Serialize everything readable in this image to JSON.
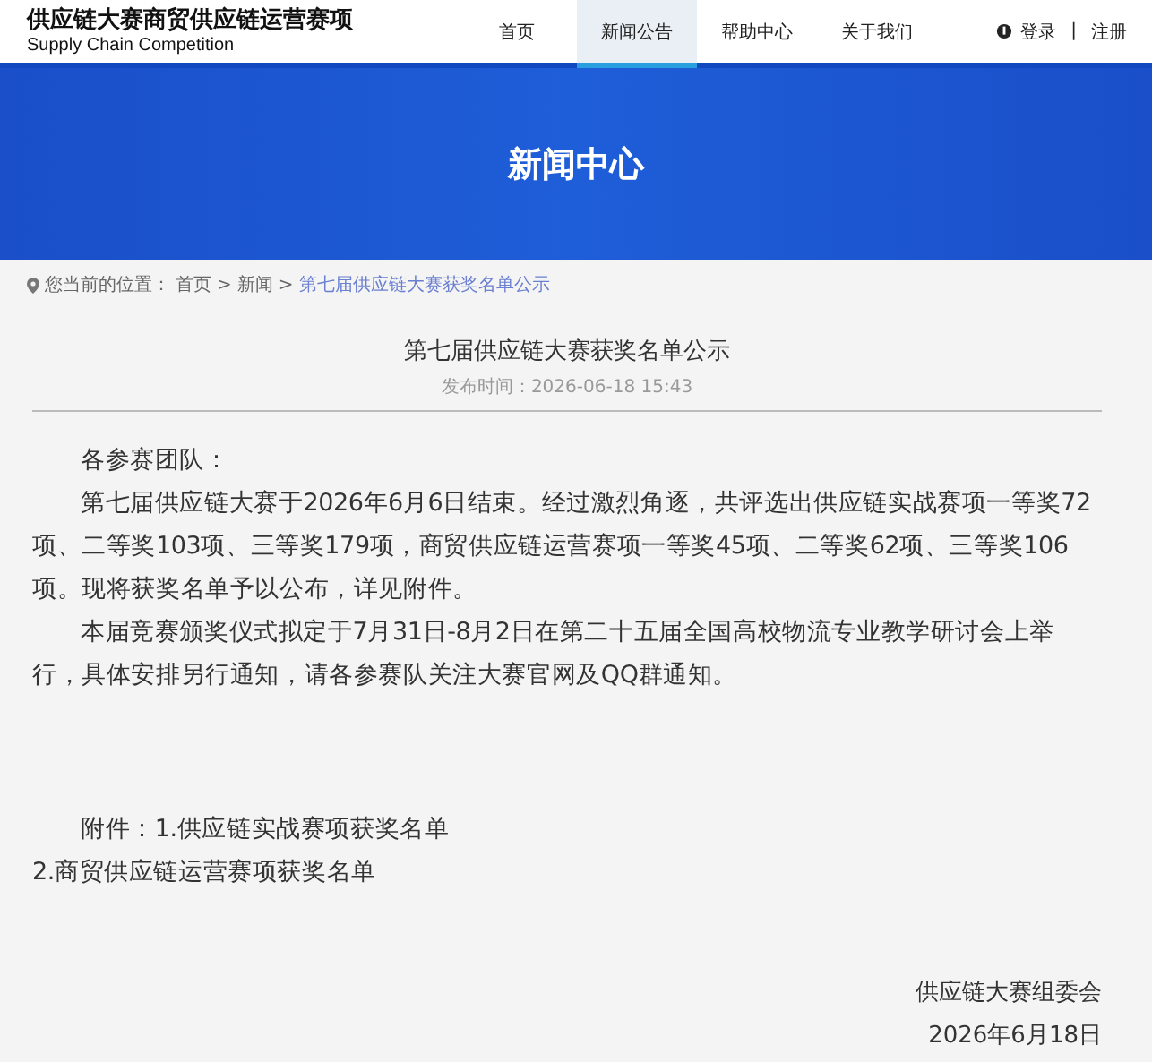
{
  "site": {
    "title": "供应链大赛商贸供应链运营赛项",
    "subtitle": "Supply Chain Competition"
  },
  "nav": [
    {
      "label": "首页",
      "selected": false
    },
    {
      "label": "新闻公告",
      "selected": true
    },
    {
      "label": "帮助中心",
      "selected": false
    },
    {
      "label": "关于我们",
      "selected": false
    }
  ],
  "account": {
    "login": "登录",
    "separator": "|",
    "register": "注册"
  },
  "banner": {
    "title": "新闻中心"
  },
  "breadcrumb": {
    "prefix": "您当前的位置：",
    "items": [
      {
        "label": "首页",
        "current": false
      },
      {
        "label": "新闻",
        "current": false
      },
      {
        "label": "第七届供应链大赛获奖名单公示",
        "current": true
      }
    ],
    "separator": ">"
  },
  "article": {
    "title": "第七届供应链大赛获奖名单公示",
    "published": "发布时间：2026-06-18 15:43",
    "paragraphs": [
      {
        "text": "各参赛团队：",
        "indent": true
      },
      {
        "text": "第七届供应链大赛于2026年6月6日结束。经过激烈角逐，共评选出供应链实战赛项一等奖72项、二等奖103项、三等奖179项，商贸供应链运营赛项一等奖45项、二等奖62项、三等奖106项。现将获奖名单予以公布，详见附件。",
        "indent": true
      },
      {
        "text": "本届竞赛颁奖仪式拟定于7月31日-8月2日在第二十五届全国高校物流专业教学研讨会上举行，具体安排另行通知，请各参赛队关注大赛官网及QQ群通知。",
        "indent": true
      }
    ],
    "attachments": [
      {
        "text": "附件：1.供应链实战赛项获奖名单",
        "indent": true
      },
      {
        "text": "2.商贸供应链运营赛项获奖名单",
        "indent": false
      }
    ],
    "signature": [
      "供应链大赛组委会",
      "2026年6月18日"
    ]
  }
}
